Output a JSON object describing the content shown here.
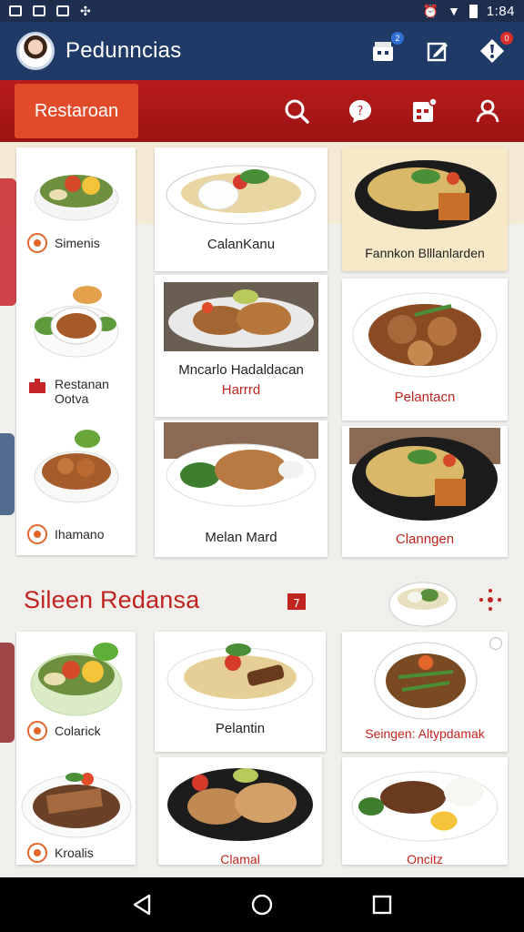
{
  "status_bar": {
    "time": "1:84"
  },
  "app_bar": {
    "title": "Pedunncias",
    "badges": {
      "cart": "2",
      "notifications": "0"
    }
  },
  "toolbar": {
    "active_tab": "Restaroan"
  },
  "side_items": [
    {
      "label": "Simenis"
    },
    {
      "label": "Restanan Ootva"
    },
    {
      "label": "Ihamano"
    }
  ],
  "grid_cards": [
    {
      "caption": "CalanKanu"
    },
    {
      "caption": "Fannkon Blllanlarden"
    },
    {
      "caption": "Mncarlo Hadaldacan",
      "subcaption": "Harrrd"
    },
    {
      "caption": "Pelantacn"
    },
    {
      "caption": "Melan Mard"
    },
    {
      "caption": "Clanngen"
    }
  ],
  "section": {
    "title": "Sileen Redansa"
  },
  "section_side_items": [
    {
      "label": "Colarick"
    },
    {
      "label": "Kroalis"
    }
  ],
  "section_cards": [
    {
      "caption": "Pelantin"
    },
    {
      "caption": "Seingen: Altypdamak"
    },
    {
      "caption": "Clamal"
    },
    {
      "caption": "Oncitz"
    }
  ],
  "colors": {
    "app_bar": "#1f3a66",
    "toolbar_red": "#b81c1c",
    "active_tab": "#e24b2a",
    "accent_red": "#c0241f",
    "icon_orange": "#e2652a"
  }
}
